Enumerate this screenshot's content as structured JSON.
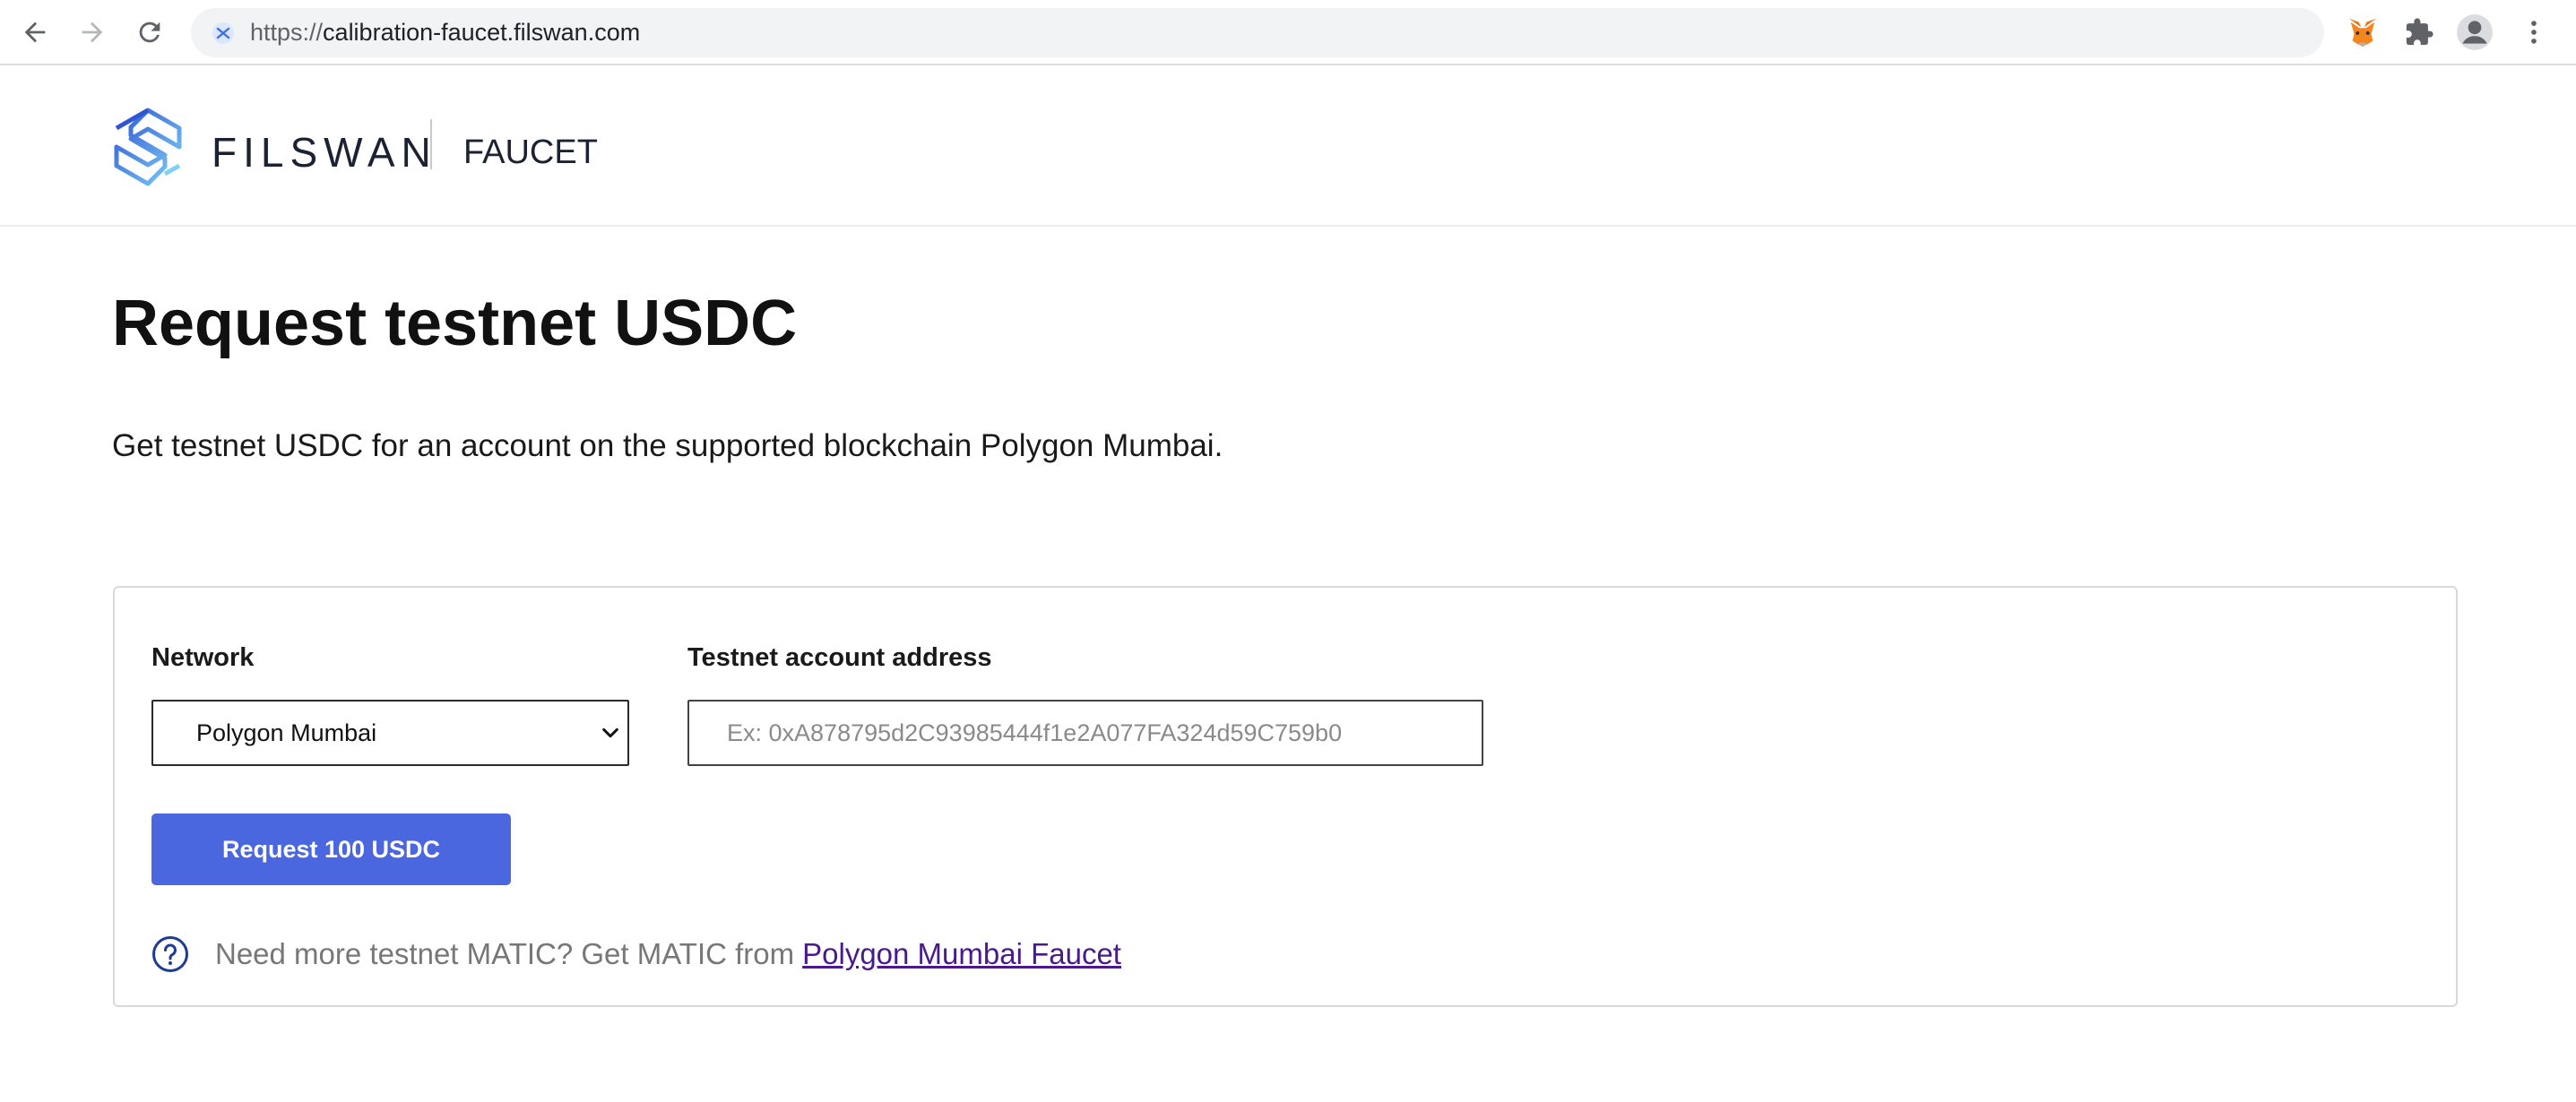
{
  "browser": {
    "url_scheme": "https://",
    "url_host": "calibration-faucet.filswan.com"
  },
  "header": {
    "logo_text": "FILSWAN",
    "section_label": "FAUCET"
  },
  "main": {
    "title": "Request testnet USDC",
    "description": "Get testnet USDC for an account on the supported blockchain Polygon Mumbai."
  },
  "form": {
    "network_label": "Network",
    "network_selected": "Polygon Mumbai",
    "address_label": "Testnet account address",
    "address_placeholder": "Ex: 0xA878795d2C93985444f1e2A077FA324d59C759b0",
    "address_value": "",
    "request_button_label": "Request 100 USDC"
  },
  "help": {
    "text": "Need more testnet MATIC? Get MATIC from",
    "link_text": "Polygon Mumbai Faucet"
  },
  "colors": {
    "accent": "#4a67df",
    "link": "#4a1a8c",
    "help_icon": "#1f3a93"
  }
}
